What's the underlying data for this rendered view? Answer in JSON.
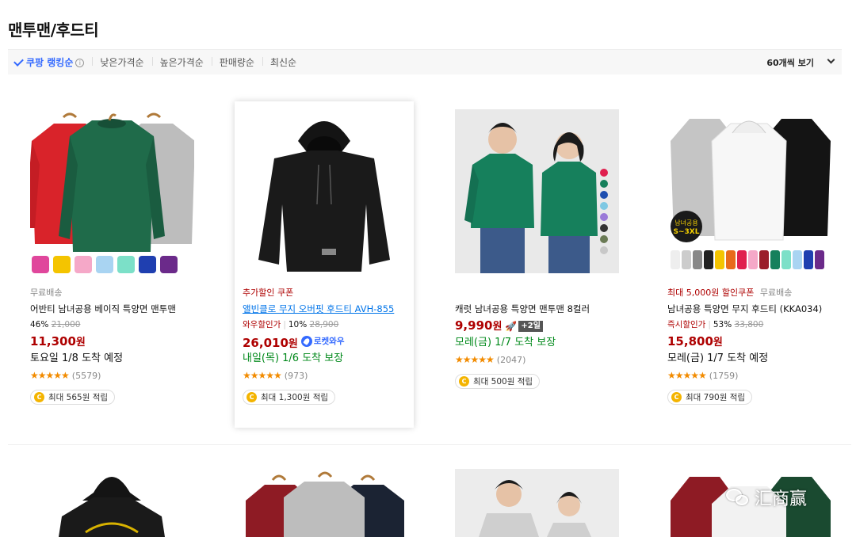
{
  "page": {
    "title": "맨투맨/후드티"
  },
  "sort": {
    "active": "쿠팡 랭킹순",
    "options": [
      "낮은가격순",
      "높은가격순",
      "판매량순",
      "최신순"
    ],
    "per_page": "60개씩 보기"
  },
  "products": [
    {
      "badge": "무료배송",
      "name": "어반티 남녀공용 베이직 특양면 맨투맨",
      "discount": "46%",
      "original_price": "21,000",
      "price": "11,300",
      "won": "원",
      "delivery": "토요일 1/8 도착 예정",
      "stars": "★★★★★",
      "rating": 4.5,
      "review_count": "(5579)",
      "reward": "최대 565원 적립"
    },
    {
      "badge": "추가할인 쿠폰",
      "name": "앨빈클로 무지 오버핏 후드티 AVH-855",
      "discount_label": "와우할인가",
      "discount": "10%",
      "original_price": "28,900",
      "price": "26,010",
      "won": "원",
      "rocket_label": "로켓와우",
      "delivery": "내일(목) 1/6 도착 보장",
      "stars": "★★★★★",
      "rating": 5,
      "review_count": "(973)",
      "reward": "최대 1,300원 적립"
    },
    {
      "name": "캐럿 남녀공용 특양면 맨투맨 8컬러",
      "price": "9,990",
      "won": "원",
      "plus_badge": "+2일",
      "delivery": "모레(금) 1/7 도착 보장",
      "stars": "★★★★★",
      "rating": 4.5,
      "review_count": "(2047)",
      "reward": "최대 500원 적립"
    },
    {
      "badge": "최대 5,000원 할인쿠폰",
      "badge2": "무료배송",
      "name": "남녀공용 특양면 무지 후드티 (KKA034)",
      "discount_label": "즉시할인가",
      "discount": "53%",
      "original_price": "33,800",
      "price": "15,800",
      "won": "원",
      "delivery": "모레(금) 1/7 도착 예정",
      "stars": "★★★★★",
      "rating": 4.5,
      "review_count": "(1759)",
      "reward": "최대 790원 적립"
    }
  ],
  "image_text": {
    "hoodie_badge_line1": "남녀공용",
    "hoodie_badge_line2": "S~3XL"
  },
  "watermark": "汇商赢",
  "colors": {
    "accent_blue": "#346aff",
    "price_red": "#ae0000",
    "delivery_green": "#00891a",
    "star_orange": "#f28b00"
  }
}
